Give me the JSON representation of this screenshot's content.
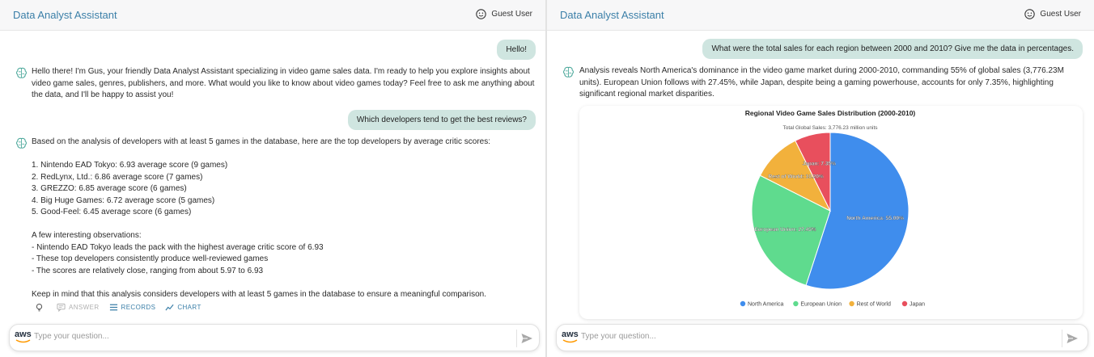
{
  "left": {
    "app_title": "Data Analyst Assistant",
    "user_name": "Guest User",
    "messages": {
      "user1": "Hello!",
      "bot1": "Hello there! I'm Gus, your friendly Data Analyst Assistant specializing in video game sales data. I'm ready to help you explore insights about video game sales, genres, publishers, and more. What would you like to know about video games today? Feel free to ask me anything about the data, and I'll be happy to assist you!",
      "user2": "Which developers tend to get the best reviews?",
      "bot2": {
        "intro": "Based on the analysis of developers with at least 5 games in the database, here are the top developers by average critic scores:",
        "list": [
          "1. Nintendo EAD Tokyo: 6.93 average score (9 games)",
          "2. RedLynx, Ltd.: 6.86 average score (7 games)",
          "3. GREZZO: 6.85 average score (6 games)",
          "4. Big Huge Games: 6.72 average score (5 games)",
          "5. Good-Feel: 6.45 average score (6 games)"
        ],
        "obs_title": "A few interesting observations:",
        "obs": [
          "- Nintendo EAD Tokyo leads the pack with the highest average critic score of 6.93",
          "- These top developers consistently produce well-reviewed games",
          "- The scores are relatively close, ranging from about 5.97 to 6.93"
        ],
        "outro": "Keep in mind that this analysis considers developers with at least 5 games in the database to ensure a meaningful comparison."
      }
    },
    "actions": {
      "answer": "ANSWER",
      "records": "RECORDS",
      "chart": "CHART"
    },
    "input": {
      "placeholder": "Type your question...",
      "value": ""
    }
  },
  "right": {
    "app_title": "Data Analyst Assistant",
    "user_name": "Guest User",
    "messages": {
      "user1": "What were the total sales for each region between 2000 and 2010? Give me the data in percentages.",
      "bot1": "Analysis reveals North America's dominance in the video game market during 2000-2010, commanding 55% of global sales (3,776.23M units). European Union follows with 27.45%, while Japan, despite being a gaming powerhouse, accounts for only 7.35%, highlighting significant regional market disparities."
    },
    "input": {
      "placeholder": "Type your question...",
      "value": ""
    }
  },
  "logo_text": "aws",
  "colors": {
    "accent": "#3b7fa8",
    "user_bubble": "#cfe5e0",
    "bot_icon": "#4aa79a"
  },
  "icons": {
    "user": "smiley-face-icon",
    "bot": "brain-icon",
    "send": "send-arrow-icon",
    "answer": "chat-icon",
    "records": "list-icon",
    "chart": "line-chart-icon",
    "feedback": "lightbulb-icon"
  },
  "chart_data": {
    "type": "pie",
    "title": "Regional Video Game Sales Distribution (2000-2010)",
    "subtitle": "Total Global Sales: 3,776.23 million units",
    "slices": [
      {
        "name": "North America",
        "value": 55.0,
        "label": "North America: 55.00%",
        "color": "#3f8ded"
      },
      {
        "name": "European Union",
        "value": 27.45,
        "label": "European Union: 27.45%",
        "color": "#5fdb8e"
      },
      {
        "name": "Rest of World",
        "value": 10.2,
        "label": "Rest of World: 10.20%",
        "color": "#f2b13c"
      },
      {
        "name": "Japan",
        "value": 7.35,
        "label": "Japan: 7.35%",
        "color": "#e84f5d"
      }
    ],
    "legend_position": "bottom"
  }
}
